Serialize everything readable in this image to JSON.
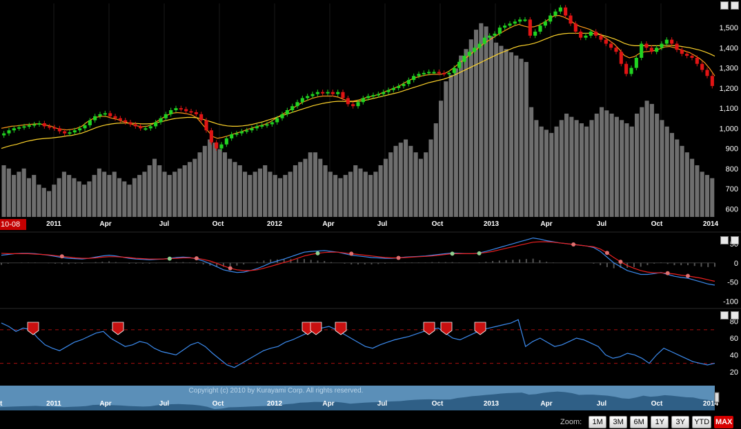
{
  "chart_data": [
    {
      "panel": "price",
      "type": "candlestick",
      "x_labels": [
        "2011",
        "Apr",
        "Jul",
        "Oct",
        "2012",
        "Apr",
        "Jul",
        "Oct",
        "2013",
        "Apr",
        "Jul",
        "Oct",
        "2014"
      ],
      "y_ticks": [
        "600",
        "700",
        "800",
        "900",
        "1,000",
        "1,100",
        "1,200",
        "1,300",
        "1,400",
        "1,500"
      ],
      "ylim": [
        560,
        1620
      ],
      "close_weekly": [
        975,
        990,
        1000,
        1005,
        1010,
        1015,
        1020,
        1025,
        1010,
        1005,
        1000,
        985,
        975,
        980,
        990,
        1000,
        1015,
        1040,
        1060,
        1070,
        1075,
        1060,
        1050,
        1040,
        1030,
        1020,
        1010,
        1000,
        1000,
        1010,
        1030,
        1050,
        1070,
        1090,
        1100,
        1095,
        1085,
        1080,
        1070,
        1040,
        990,
        930,
        900,
        920,
        950,
        970,
        975,
        985,
        990,
        1000,
        1010,
        1015,
        1020,
        1030,
        1050,
        1070,
        1090,
        1110,
        1130,
        1150,
        1160,
        1170,
        1180,
        1175,
        1180,
        1170,
        1180,
        1150,
        1120,
        1110,
        1130,
        1150,
        1160,
        1165,
        1170,
        1180,
        1190,
        1200,
        1210,
        1220,
        1240,
        1260,
        1270,
        1275,
        1280,
        1280,
        1275,
        1270,
        1275,
        1300,
        1330,
        1360,
        1380,
        1400,
        1420,
        1450,
        1460,
        1470,
        1500,
        1510,
        1520,
        1530,
        1540,
        1540,
        1460,
        1480,
        1510,
        1530,
        1560,
        1580,
        1600,
        1560,
        1520,
        1480,
        1450,
        1460,
        1480,
        1460,
        1440,
        1420,
        1400,
        1380,
        1320,
        1270,
        1300,
        1350,
        1420,
        1400,
        1380,
        1400,
        1420,
        1440,
        1420,
        1390,
        1370,
        1360,
        1350,
        1320,
        1290,
        1260,
        1210
      ],
      "volume_weekly": [
        720,
        710,
        690,
        700,
        710,
        680,
        690,
        660,
        650,
        640,
        660,
        680,
        700,
        690,
        680,
        670,
        660,
        670,
        690,
        710,
        700,
        690,
        700,
        680,
        670,
        660,
        680,
        690,
        700,
        720,
        740,
        720,
        700,
        690,
        700,
        710,
        720,
        730,
        740,
        760,
        780,
        800,
        790,
        770,
        760,
        740,
        730,
        720,
        700,
        690,
        700,
        710,
        720,
        700,
        690,
        680,
        690,
        700,
        720,
        730,
        740,
        760,
        760,
        740,
        720,
        700,
        690,
        680,
        690,
        700,
        720,
        710,
        700,
        690,
        700,
        720,
        740,
        760,
        780,
        790,
        800,
        780,
        760,
        740,
        760,
        800,
        850,
        920,
        980,
        1000,
        1020,
        1060,
        1080,
        1110,
        1140,
        1160,
        1150,
        1120,
        1100,
        1090,
        1080,
        1070,
        1060,
        1050,
        1040,
        900,
        860,
        840,
        830,
        820,
        840,
        860,
        880,
        870,
        860,
        850,
        840,
        860,
        880,
        900,
        890,
        880,
        870,
        860,
        850,
        840,
        880,
        900,
        920,
        910,
        880,
        860,
        840,
        820,
        800,
        780,
        760,
        740,
        720,
        700,
        690,
        680
      ],
      "series": [
        {
          "name": "",
          "color": "#ff9a1a",
          "values": [
            1000,
            1005,
            1010,
            1012,
            1015,
            1018,
            1020,
            1022,
            1020,
            1015,
            1010,
            1000,
            995,
            992,
            995,
            1000,
            1010,
            1030,
            1045,
            1055,
            1060,
            1058,
            1050,
            1045,
            1035,
            1028,
            1020,
            1012,
            1008,
            1010,
            1020,
            1035,
            1050,
            1065,
            1075,
            1078,
            1076,
            1072,
            1065,
            1050,
            1020,
            990,
            960,
            950,
            955,
            962,
            970,
            978,
            985,
            995,
            1002,
            1010,
            1016,
            1025,
            1040,
            1055,
            1070,
            1085,
            1100,
            1115,
            1130,
            1140,
            1150,
            1156,
            1160,
            1160,
            1160,
            1155,
            1145,
            1135,
            1135,
            1140,
            1148,
            1155,
            1160,
            1168,
            1178,
            1188,
            1198,
            1208,
            1222,
            1236,
            1248,
            1256,
            1262,
            1266,
            1268,
            1268,
            1270,
            1282,
            1300,
            1320,
            1340,
            1360,
            1380,
            1400,
            1420,
            1436,
            1452,
            1468,
            1482,
            1496,
            1508,
            1516,
            1508,
            1502,
            1504,
            1512,
            1526,
            1542,
            1558,
            1560,
            1552,
            1540,
            1522,
            1508,
            1500,
            1492,
            1480,
            1468,
            1452,
            1436,
            1418,
            1392,
            1362,
            1350,
            1356,
            1372,
            1380,
            1382,
            1386,
            1394,
            1404,
            1406,
            1400,
            1392,
            1384,
            1376,
            1362,
            1346,
            1326,
            1296,
            1260
          ]
        },
        {
          "name": "",
          "color": "#ffd42a",
          "values": [
            900,
            908,
            915,
            920,
            928,
            935,
            940,
            945,
            948,
            950,
            952,
            955,
            958,
            962,
            965,
            970,
            976,
            985,
            995,
            1005,
            1012,
            1018,
            1022,
            1025,
            1026,
            1026,
            1025,
            1024,
            1022,
            1022,
            1024,
            1028,
            1034,
            1040,
            1046,
            1050,
            1052,
            1054,
            1054,
            1052,
            1046,
            1038,
            1030,
            1022,
            1016,
            1012,
            1010,
            1010,
            1012,
            1015,
            1020,
            1026,
            1032,
            1040,
            1048,
            1056,
            1064,
            1072,
            1080,
            1088,
            1096,
            1104,
            1112,
            1118,
            1124,
            1128,
            1132,
            1134,
            1134,
            1132,
            1132,
            1134,
            1138,
            1142,
            1148,
            1154,
            1160,
            1166,
            1172,
            1178,
            1186,
            1194,
            1202,
            1210,
            1218,
            1226,
            1232,
            1238,
            1244,
            1252,
            1262,
            1274,
            1286,
            1298,
            1310,
            1322,
            1334,
            1346,
            1358,
            1370,
            1380,
            1390,
            1400,
            1408,
            1412,
            1416,
            1422,
            1430,
            1440,
            1450,
            1460,
            1466,
            1470,
            1472,
            1472,
            1472,
            1472,
            1472,
            1470,
            1466,
            1460,
            1452,
            1444,
            1434,
            1422,
            1414,
            1410,
            1410,
            1410,
            1410,
            1410,
            1410,
            1412,
            1412,
            1410,
            1408,
            1404,
            1400,
            1394,
            1388,
            1380,
            1370,
            1358
          ]
        }
      ]
    },
    {
      "panel": "macd",
      "type": "line",
      "y_ticks": [
        "50",
        "0",
        "-50",
        "-100"
      ],
      "ylim": [
        -110,
        75
      ],
      "series": [
        {
          "name": "",
          "color": "#3c8cf0",
          "values": [
            20,
            22,
            24,
            25,
            25,
            24,
            22,
            20,
            17,
            14,
            12,
            11,
            10,
            12,
            15,
            18,
            20,
            18,
            15,
            12,
            10,
            9,
            8,
            9,
            10,
            12,
            14,
            15,
            14,
            10,
            5,
            -2,
            -10,
            -18,
            -22,
            -25,
            -24,
            -20,
            -15,
            -8,
            0,
            5,
            10,
            16,
            22,
            28,
            30,
            31,
            32,
            30,
            28,
            24,
            20,
            18,
            16,
            14,
            13,
            12,
            12,
            13,
            15,
            16,
            17,
            18,
            20,
            22,
            24,
            26,
            25,
            24,
            24,
            26,
            30,
            35,
            40,
            45,
            50,
            55,
            60,
            65,
            62,
            58,
            55,
            52,
            50,
            48,
            46,
            44,
            40,
            30,
            15,
            0,
            -10,
            -20,
            -25,
            -30,
            -30,
            -28,
            -25,
            -30,
            -35,
            -38,
            -40,
            -45,
            -50,
            -55,
            -58
          ]
        },
        {
          "name": "",
          "color": "#ee2020",
          "values": [
            25,
            24,
            24,
            24,
            24,
            23,
            22,
            21,
            19,
            17,
            15,
            13,
            12,
            12,
            13,
            15,
            16,
            16,
            15,
            14,
            12,
            11,
            10,
            10,
            10,
            11,
            12,
            13,
            13,
            12,
            9,
            5,
            -1,
            -8,
            -14,
            -18,
            -20,
            -20,
            -18,
            -14,
            -9,
            -4,
            1,
            6,
            12,
            18,
            22,
            25,
            27,
            28,
            28,
            26,
            24,
            22,
            20,
            18,
            16,
            14,
            13,
            13,
            14,
            15,
            16,
            17,
            18,
            20,
            22,
            24,
            24,
            24,
            24,
            25,
            27,
            30,
            34,
            38,
            42,
            46,
            50,
            54,
            55,
            55,
            54,
            52,
            50,
            48,
            46,
            44,
            42,
            36,
            26,
            14,
            3,
            -7,
            -14,
            -20,
            -24,
            -26,
            -26,
            -27,
            -29,
            -32,
            -34,
            -37,
            -40,
            -44,
            -48
          ]
        }
      ]
    },
    {
      "panel": "rsi",
      "type": "line",
      "y_ticks": [
        "80",
        "60",
        "40",
        "20"
      ],
      "ylim": [
        10,
        92
      ],
      "series": [
        {
          "name": "",
          "color": "#3c8cf0",
          "values": [
            78,
            74,
            68,
            72,
            70,
            60,
            52,
            48,
            45,
            50,
            55,
            58,
            62,
            66,
            68,
            60,
            55,
            50,
            52,
            56,
            54,
            48,
            44,
            42,
            40,
            46,
            52,
            55,
            50,
            42,
            35,
            28,
            25,
            30,
            35,
            40,
            45,
            48,
            50,
            55,
            58,
            62,
            66,
            70,
            72,
            74,
            70,
            65,
            60,
            55,
            50,
            48,
            52,
            55,
            58,
            60,
            62,
            65,
            68,
            70,
            72,
            66,
            60,
            58,
            62,
            66,
            70,
            72,
            74,
            76,
            78,
            82,
            50,
            56,
            60,
            55,
            50,
            52,
            56,
            60,
            58,
            54,
            50,
            40,
            36,
            38,
            42,
            40,
            36,
            30,
            40,
            48,
            44,
            40,
            36,
            32,
            30,
            28,
            30
          ]
        }
      ]
    }
  ],
  "xaxis": {
    "labels": [
      "2011",
      "Apr",
      "Jul",
      "Oct",
      "2012",
      "Apr",
      "Jul",
      "Oct",
      "2013",
      "Apr",
      "Jul",
      "Oct",
      "2014"
    ]
  },
  "nav_axis": {
    "labels": [
      "2011",
      "Apr",
      "Jul",
      "Oct",
      "2012",
      "Apr",
      "Jul",
      "Oct",
      "2013",
      "Apr",
      "Jul",
      "Oct",
      "2014"
    ],
    "partial_left": "t"
  },
  "date_badge": "10-08",
  "copyright": "Copyright (c) 2010 by Kurayami Corp. All rights reserved.",
  "zoom": {
    "label": "Zoom:",
    "buttons": [
      "1M",
      "3M",
      "6M",
      "1Y",
      "3Y",
      "YTD",
      "MAX"
    ],
    "active": "MAX"
  },
  "colors": {
    "up": "#21d321",
    "down": "#e01414",
    "volume": "#6e6e6e",
    "nav_fill": "#5b8fb8",
    "badge": "#c40000"
  }
}
